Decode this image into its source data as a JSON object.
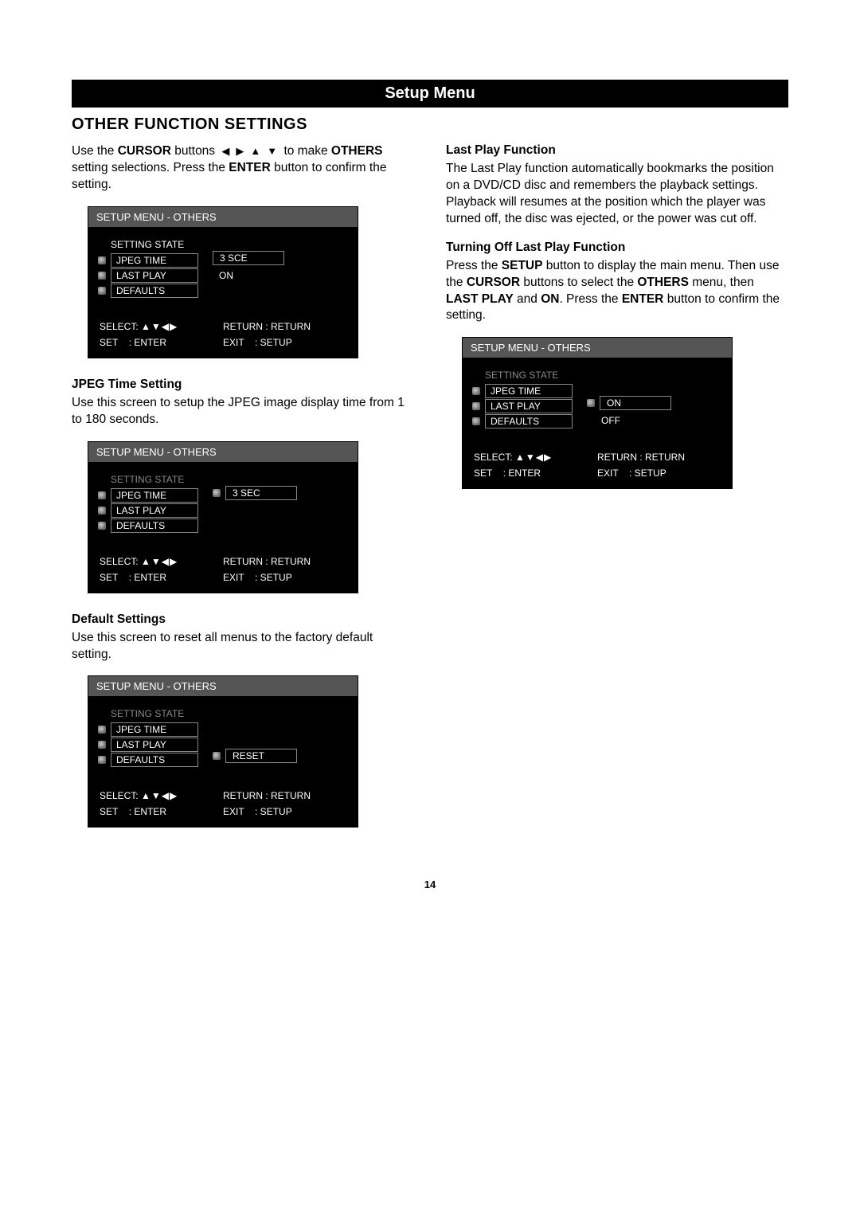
{
  "banner": "Setup Menu",
  "heading": "OTHER FUNCTION SETTINGS",
  "left": {
    "intro_pre": "Use the ",
    "intro_cursor": "CURSOR",
    "intro_mid": " buttons ",
    "intro_post": " to make ",
    "intro_line2a": "OTHERS",
    "intro_line2b": " setting selections. Press the ",
    "intro_enter": "ENTER",
    "intro_line2c": " button to confirm the setting.",
    "jpeg_heading": "JPEG Time Setting",
    "jpeg_text": "Use this screen to setup the JPEG image display time from 1 to 180 seconds.",
    "defaults_heading": "Default Settings",
    "defaults_text": "Use this screen to reset all menus to the factory default setting."
  },
  "right": {
    "lastplay_heading": "Last Play Function",
    "lastplay_text": "The Last Play function automatically bookmarks the position on a DVD/CD disc and remembers the playback settings. Playback will resumes at the position which the player was turned off, the disc was ejected, or the power was cut off.",
    "turnoff_heading": "Turning Off Last Play Function",
    "turnoff_a": "Press the ",
    "turnoff_setup": "SETUP",
    "turnoff_b": " button to display the main menu. Then use the ",
    "turnoff_cursor": "CURSOR",
    "turnoff_c": " buttons to select the ",
    "turnoff_others": "OTHERS",
    "turnoff_d": " menu, then ",
    "turnoff_lastplay": "LAST PLAY",
    "turnoff_e": " and ",
    "turnoff_on": "ON",
    "turnoff_f": ". Press the ",
    "turnoff_enter": "ENTER",
    "turnoff_g": " button to confirm the setting."
  },
  "osd_common": {
    "title": "SETUP MENU - OTHERS",
    "items": [
      "SETTING STATE",
      "JPEG TIME",
      "LAST PLAY",
      "DEFAULTS"
    ],
    "footer_select": "SELECT:",
    "footer_return": "RETURN : RETURN",
    "footer_set": "SET",
    "footer_enter": ": ENTER",
    "footer_exit": "EXIT",
    "footer_setup": ": SETUP"
  },
  "osd1": {
    "val1": "3 SCE",
    "val2": "ON"
  },
  "osd2": {
    "val1": "3 SEC"
  },
  "osd3": {
    "val1": "RESET"
  },
  "osd4": {
    "val1": "ON",
    "val2": "OFF"
  },
  "page": "14"
}
